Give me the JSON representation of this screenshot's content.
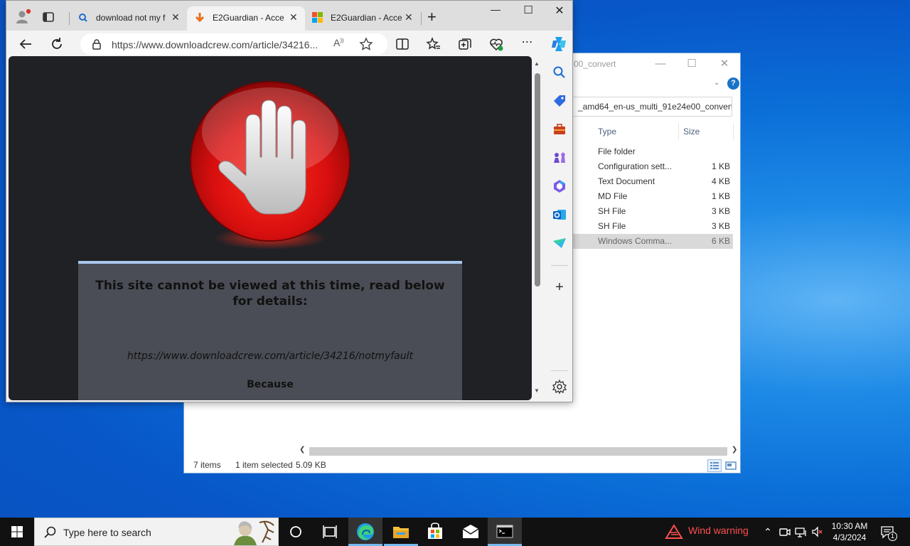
{
  "explorer": {
    "title": "00_convert",
    "address": "_amd64_en-us_multi_91e24e00_convert",
    "columns": {
      "type": "Type",
      "size": "Size"
    },
    "rows": [
      {
        "type": "File folder",
        "size": ""
      },
      {
        "type": "Configuration sett...",
        "size": "1 KB"
      },
      {
        "type": "Text Document",
        "size": "4 KB"
      },
      {
        "type": "MD File",
        "size": "1 KB"
      },
      {
        "type": "SH File",
        "size": "3 KB"
      },
      {
        "type": "SH File",
        "size": "3 KB"
      },
      {
        "type": "Windows Comma...",
        "size": "6 KB"
      }
    ],
    "status": {
      "items": "7 items",
      "selected": "1 item selected",
      "size": "5.09 KB"
    }
  },
  "edge": {
    "tabs": [
      {
        "label": "download not my f",
        "favicon": "search-icon"
      },
      {
        "label": "E2Guardian - Acce",
        "favicon": "download-arrow-icon"
      },
      {
        "label": "E2Guardian - Acce",
        "favicon": "windows-logo-icon"
      }
    ],
    "url": "https://www.downloadcrew.com/article/34216...",
    "page": {
      "message": "This site cannot be viewed at this time, read below for details:",
      "blocked_url": "https://www.downloadcrew.com/article/34216/notmyfault",
      "because": "Because"
    }
  },
  "taskbar": {
    "search_placeholder": "Type here to search",
    "warning": "Wind warning",
    "time": "10:30 AM",
    "date": "4/3/2024",
    "notification_count": "1"
  }
}
